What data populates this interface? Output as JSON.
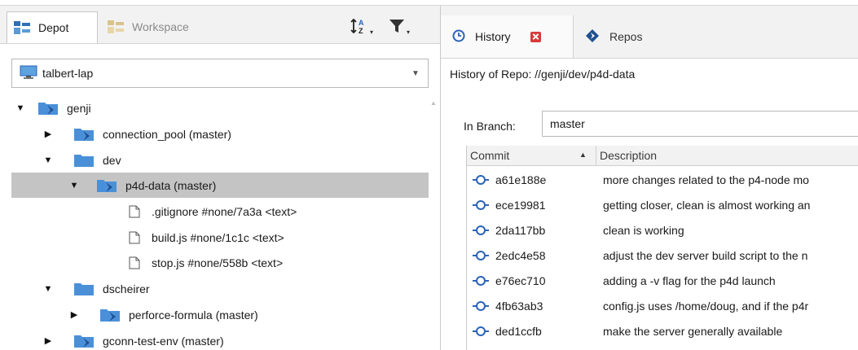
{
  "left_tabs": [
    {
      "label": "Depot",
      "active": true
    },
    {
      "label": "Workspace",
      "active": false
    }
  ],
  "toolbar": {
    "sort_icon": "sort-az-icon",
    "filter_icon": "filter-icon"
  },
  "workspace_selector": {
    "value": "talbert-lap",
    "icon": "computer-icon"
  },
  "tree": {
    "root": "genji",
    "connection_pool": "connection_pool (master)",
    "dev": "dev",
    "p4d_data": "p4d-data (master)",
    "files": [
      ".gitignore #none/7a3a <text>",
      "build.js #none/1c1c <text>",
      "stop.js #none/558b <text>"
    ],
    "dscheirer": "dscheirer",
    "perforce_formula": "perforce-formula (master)",
    "gconn": "gconn-test-env (master)"
  },
  "right_tabs": [
    {
      "label": "History",
      "active": true
    },
    {
      "label": "Repos",
      "active": false
    }
  ],
  "history": {
    "title": "History of Repo: //genji/dev/p4d-data",
    "branch_label": "In Branch:",
    "branch_value": "master",
    "columns": [
      "Commit",
      "Description"
    ],
    "commits": [
      {
        "hash": "a61e188e",
        "desc": "more changes related to the p4-node mo"
      },
      {
        "hash": "ece19981",
        "desc": "getting closer, clean is almost working an"
      },
      {
        "hash": "2da117bb",
        "desc": "clean is working"
      },
      {
        "hash": "2edc4e58",
        "desc": "adjust the dev server build script to the n"
      },
      {
        "hash": "e76ec710",
        "desc": "adding a -v flag for the p4d launch"
      },
      {
        "hash": "4fb63ab3",
        "desc": "config.js uses /home/doug, and if the p4r"
      },
      {
        "hash": "ded1ccfb",
        "desc": "make the server generally available"
      }
    ]
  },
  "colors": {
    "accent_blue": "#2a63b8",
    "folder_blue": "#4a90d9",
    "selection": "#c4c4c4",
    "close_red": "#d93a3a"
  }
}
